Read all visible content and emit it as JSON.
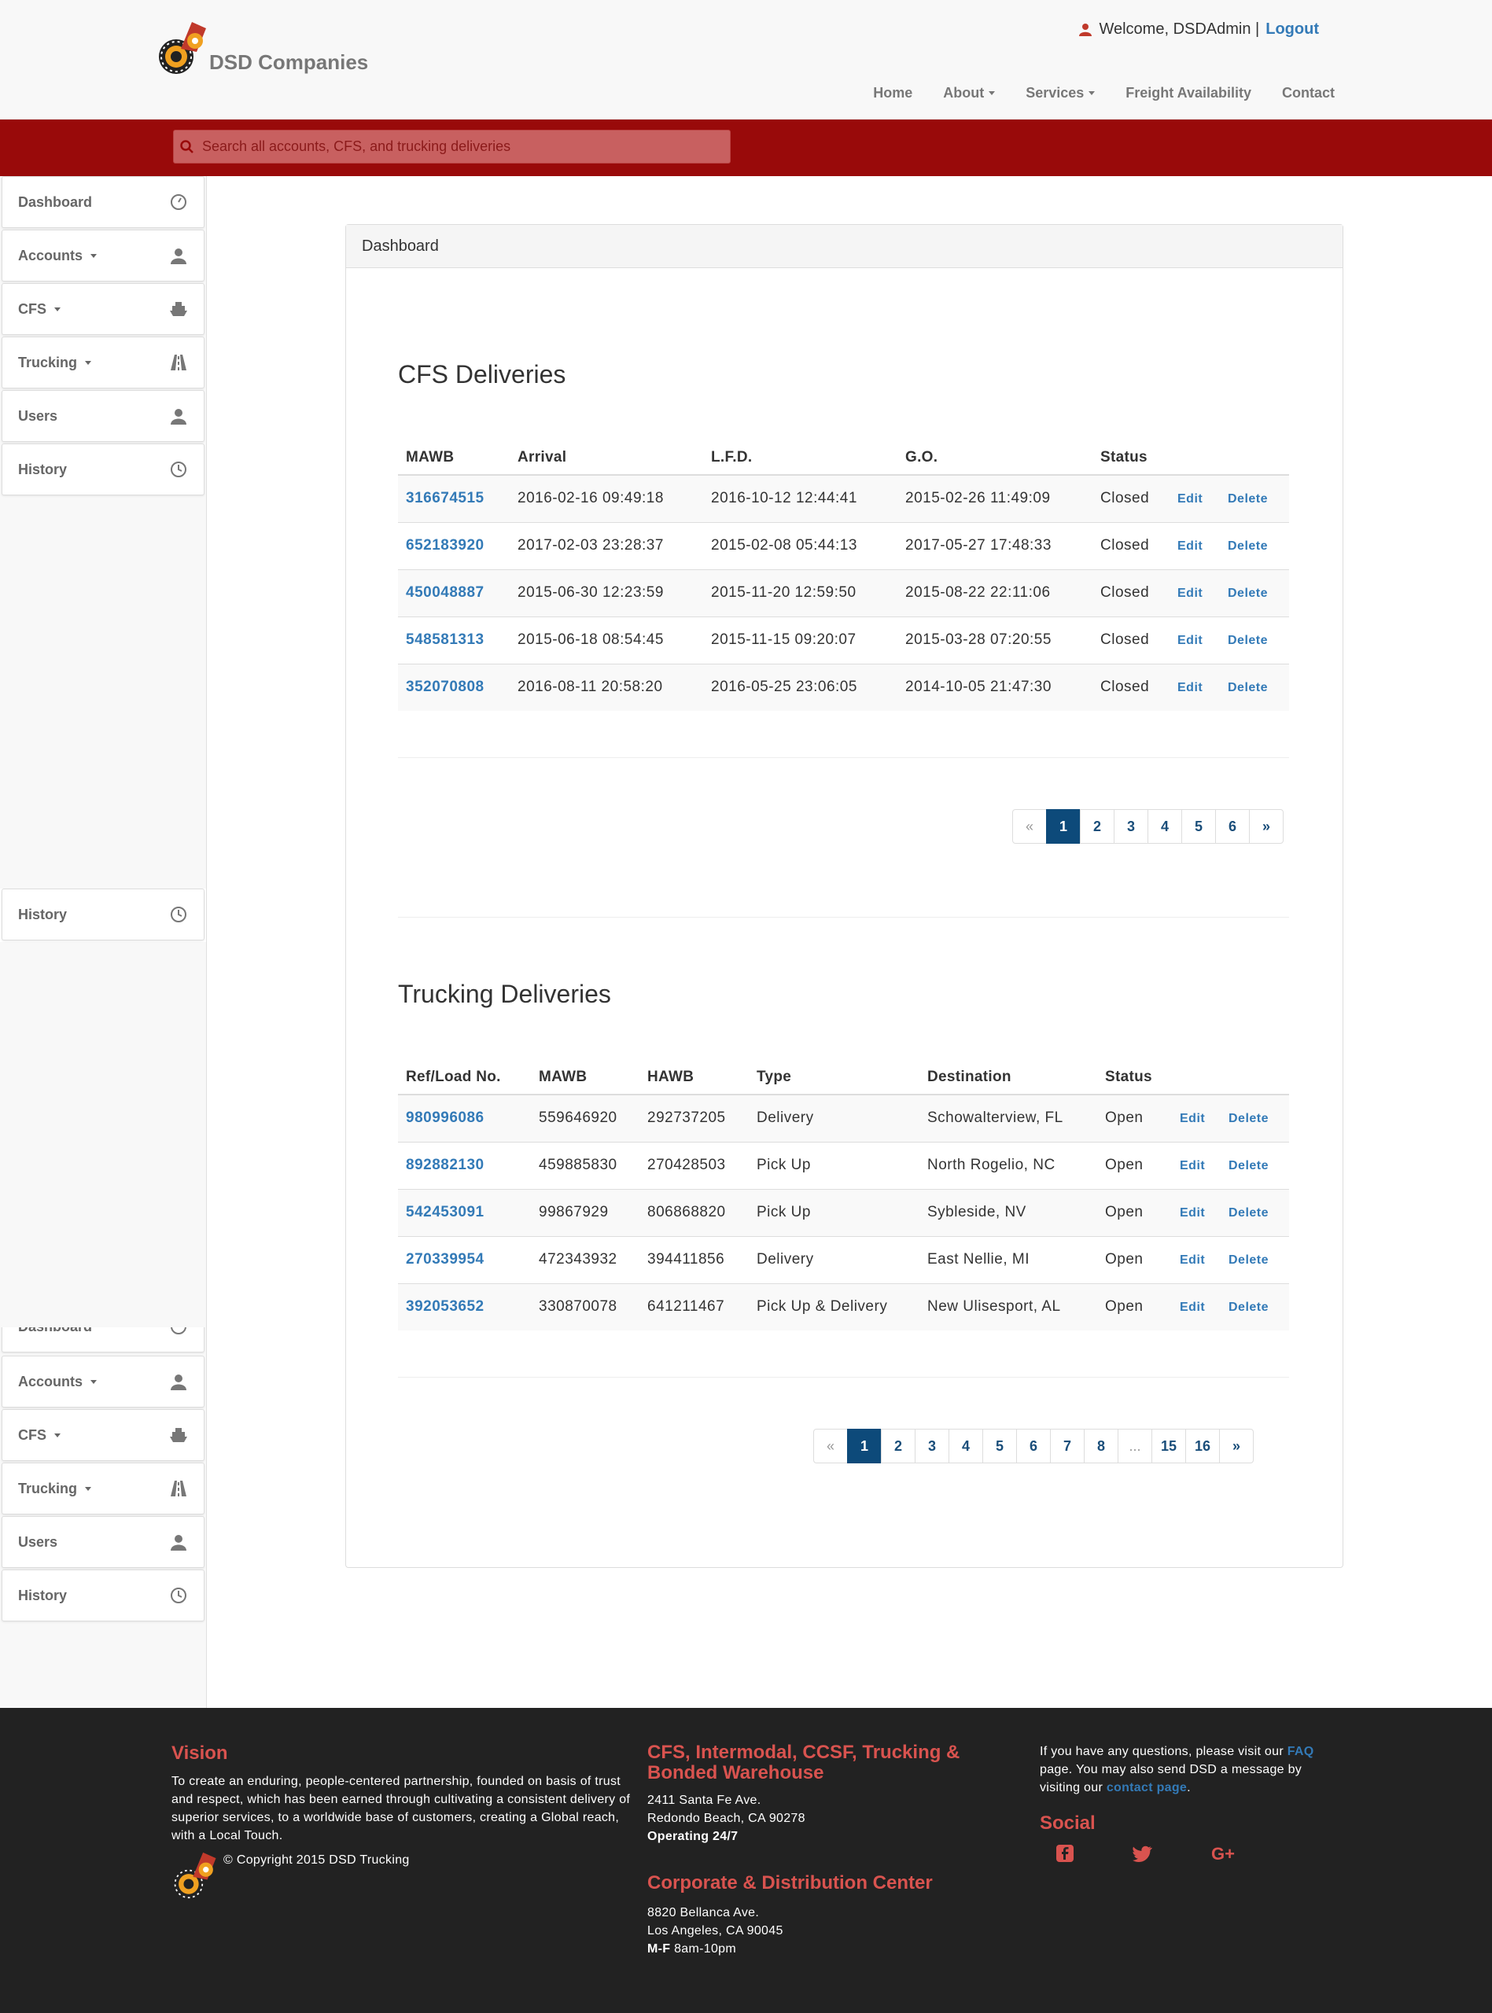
{
  "header": {
    "brand": "DSD Companies",
    "welcome": "Welcome, DSDAdmin |",
    "logout": "Logout",
    "nav": [
      "Home",
      "About",
      "Services",
      "Freight Availability",
      "Contact"
    ]
  },
  "search": {
    "placeholder": "Search all accounts, CFS, and trucking deliveries"
  },
  "sidebar": {
    "items": [
      {
        "label": "Dashboard",
        "icon": "dashboard-icon"
      },
      {
        "label": "Accounts",
        "icon": "user-icon"
      },
      {
        "label": "CFS",
        "icon": "ship-icon"
      },
      {
        "label": "Trucking",
        "icon": "road-icon"
      },
      {
        "label": "Users",
        "icon": "user-icon"
      },
      {
        "label": "History",
        "icon": "clock-icon"
      }
    ]
  },
  "panel": {
    "heading": "Dashboard"
  },
  "cfs": {
    "title": "CFS Deliveries",
    "columns": [
      "MAWB",
      "Arrival",
      "L.F.D.",
      "G.O.",
      "Status"
    ],
    "rows": [
      {
        "mawb": "316674515",
        "arrival": "2016-02-16 09:49:18",
        "lfd": "2016-10-12 12:44:41",
        "go": "2015-02-26 11:49:09",
        "status": "Closed"
      },
      {
        "mawb": "652183920",
        "arrival": "2017-02-03 23:28:37",
        "lfd": "2015-02-08 05:44:13",
        "go": "2017-05-27 17:48:33",
        "status": "Closed"
      },
      {
        "mawb": "450048887",
        "arrival": "2015-06-30 12:23:59",
        "lfd": "2015-11-20 12:59:50",
        "go": "2015-08-22 22:11:06",
        "status": "Closed"
      },
      {
        "mawb": "548581313",
        "arrival": "2015-06-18 08:54:45",
        "lfd": "2015-11-15 09:20:07",
        "go": "2015-03-28 07:20:55",
        "status": "Closed"
      },
      {
        "mawb": "352070808",
        "arrival": "2016-08-11 20:58:20",
        "lfd": "2016-05-25 23:06:05",
        "go": "2014-10-05 21:47:30",
        "status": "Closed"
      }
    ],
    "pages": [
      "«",
      "1",
      "2",
      "3",
      "4",
      "5",
      "6",
      "»"
    ]
  },
  "trucking": {
    "title": "Trucking Deliveries",
    "columns": [
      "Ref/Load No.",
      "MAWB",
      "HAWB",
      "Type",
      "Destination",
      "Status"
    ],
    "rows": [
      {
        "ref": "980996086",
        "mawb": "559646920",
        "hawb": "292737205",
        "type": "Delivery",
        "dest": "Schowalterview, FL",
        "status": "Open"
      },
      {
        "ref": "892882130",
        "mawb": "459885830",
        "hawb": "270428503",
        "type": "Pick Up",
        "dest": "North Rogelio, NC",
        "status": "Open"
      },
      {
        "ref": "542453091",
        "mawb": "99867929",
        "hawb": "806868820",
        "type": "Pick Up",
        "dest": "Sybleside, NV",
        "status": "Open"
      },
      {
        "ref": "270339954",
        "mawb": "472343932",
        "hawb": "394411856",
        "type": "Delivery",
        "dest": "East Nellie, MI",
        "status": "Open"
      },
      {
        "ref": "392053652",
        "mawb": "330870078",
        "hawb": "641211467",
        "type": "Pick Up & Delivery",
        "dest": "New Ulisesport, AL",
        "status": "Open"
      }
    ],
    "pages": [
      "«",
      "1",
      "2",
      "3",
      "4",
      "5",
      "6",
      "7",
      "8",
      "...",
      "15",
      "16",
      "»"
    ]
  },
  "actions": {
    "edit": "Edit",
    "delete": "Delete"
  },
  "footer": {
    "vision_title": "Vision",
    "vision_text": "To create an enduring, people-centered partnership, founded on basis of trust and respect, which has been earned through cultivating a consistent delivery of superior services, to a worldwide base of customers, creating a Global reach, with a Local Touch.",
    "copyright": "© Copyright 2015 DSD Trucking",
    "cfs_title": "CFS, Intermodal, CCSF, Trucking & Bonded Warehouse",
    "cfs_addr1": "2411 Santa Fe Ave.",
    "cfs_addr2": "Redondo Beach, CA 90278",
    "cfs_hours": "Operating 24/7",
    "corp_title": "Corporate & Distribution Center",
    "corp_addr1": "8820 Bellanca Ave.",
    "corp_addr2": "Los Angeles, CA 90045",
    "corp_hours_bold": "M-F",
    "corp_hours": " 8am-10pm",
    "help_1": "If you have any questions, please visit our ",
    "help_faq": "FAQ",
    "help_2": " page. You may also send DSD a message by visiting our ",
    "help_contact": "contact page",
    "help_3": ".",
    "social_title": "Social",
    "colors": {
      "accent": "#d9534f",
      "footer_bg": "#222222",
      "redbar": "#990a0a",
      "link": "#337ab7"
    }
  }
}
